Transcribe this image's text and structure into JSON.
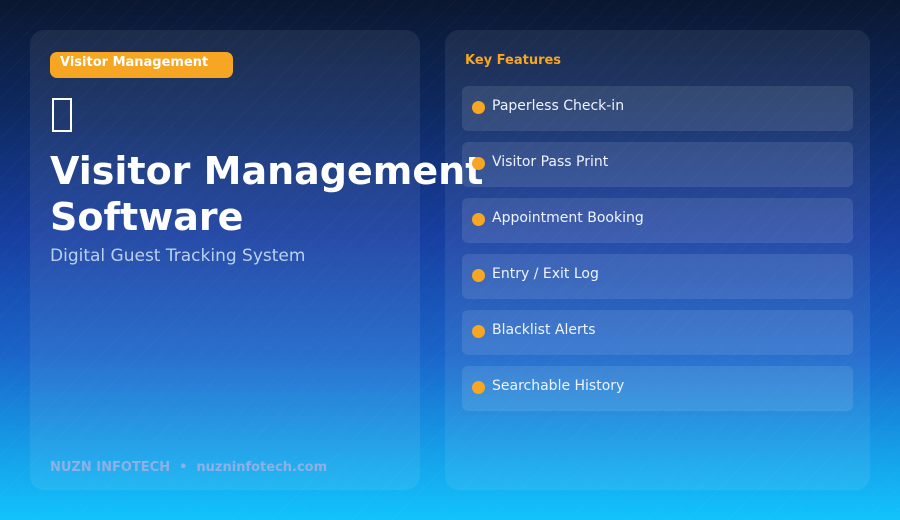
{
  "hero": {
    "badge": "Visitor Management",
    "title": "Visitor Management Software",
    "subtitle": "Digital Guest Tracking System",
    "icon": "missing-glyph-icon"
  },
  "footer": {
    "company": "NUZN INFOTECH",
    "separator": "•",
    "website": "nuzninfotech.com"
  },
  "features": {
    "heading": "Key Features",
    "items": [
      {
        "label": "Paperless Check-in"
      },
      {
        "label": "Visitor Pass Print"
      },
      {
        "label": "Appointment Booking"
      },
      {
        "label": "Entry / Exit Log"
      },
      {
        "label": "Blacklist Alerts"
      },
      {
        "label": "Searchable History"
      }
    ]
  },
  "colors": {
    "accent": "#f6a623",
    "background_top": "#0a1730",
    "background_bottom": "#12c3fb"
  }
}
